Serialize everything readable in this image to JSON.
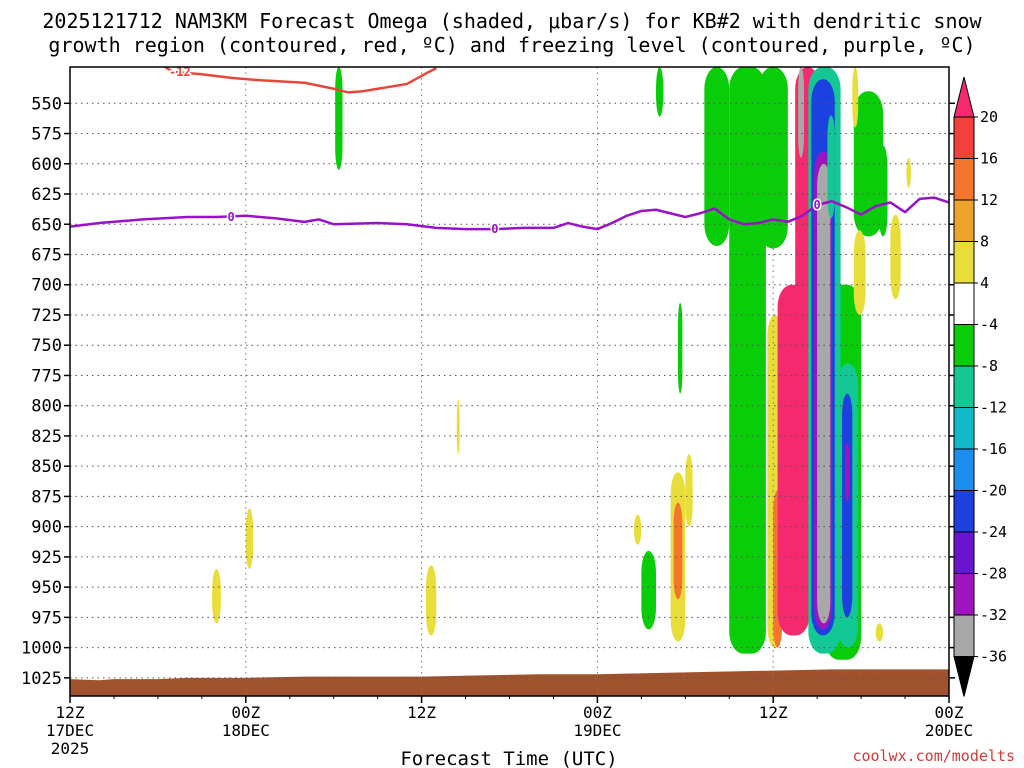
{
  "chart_data": {
    "type": "heatmap",
    "title_line1": "2025121712 NAM3KM Forecast Omega (shaded, μbar/s) for KB#2 with dendritic snow",
    "title_line2": "growth region (contoured, red, ºC) and freezing level (contoured, purple, ºC)",
    "xlabel": "Forecast Time (UTC)",
    "credit": "coolwx.com/modelts",
    "y_axis": {
      "unit": "hPa",
      "ticks": [
        550,
        575,
        600,
        625,
        650,
        675,
        700,
        725,
        750,
        775,
        800,
        825,
        850,
        875,
        900,
        925,
        950,
        975,
        1000,
        1025
      ],
      "range_top": 520,
      "range_bottom": 1040
    },
    "x_axis": {
      "range_hours": [
        0,
        60
      ],
      "ticks": [
        {
          "hour": 0,
          "lines": [
            "12Z",
            "17DEC",
            "2025"
          ]
        },
        {
          "hour": 12,
          "lines": [
            "00Z",
            "18DEC"
          ]
        },
        {
          "hour": 24,
          "lines": [
            "12Z"
          ]
        },
        {
          "hour": 36,
          "lines": [
            "00Z",
            "19DEC"
          ]
        },
        {
          "hour": 48,
          "lines": [
            "12Z"
          ]
        },
        {
          "hour": 60,
          "lines": [
            "00Z",
            "20DEC"
          ]
        }
      ]
    },
    "colorbar": {
      "levels": [
        20,
        16,
        12,
        8,
        4,
        -4,
        -8,
        -12,
        -16,
        -20,
        -24,
        -28,
        -32,
        -36
      ],
      "colors": [
        "#f52a6e",
        "#f2413a",
        "#f3762c",
        "#f0a32c",
        "#e9dd3a",
        "#ffffff",
        "#0acd0a",
        "#14c896",
        "#10b9c8",
        "#1c8ef0",
        "#1d40e0",
        "#6a14d0",
        "#a014c0",
        "#a8a8a8",
        "#000000"
      ],
      "legend_order": "top-to-bottom"
    },
    "freezing_level": {
      "label": "0",
      "color": "#9a12c8",
      "points": [
        [
          0,
          652
        ],
        [
          2,
          649
        ],
        [
          5,
          646
        ],
        [
          8,
          644
        ],
        [
          10,
          644
        ],
        [
          12,
          643
        ],
        [
          14,
          645
        ],
        [
          16,
          648
        ],
        [
          17,
          646
        ],
        [
          18,
          650
        ],
        [
          21,
          649
        ],
        [
          23,
          650
        ],
        [
          25,
          653
        ],
        [
          27,
          654
        ],
        [
          29,
          654
        ],
        [
          31,
          653
        ],
        [
          33,
          653
        ],
        [
          34,
          649
        ],
        [
          35,
          652
        ],
        [
          36,
          654
        ],
        [
          37,
          649
        ],
        [
          38,
          643
        ],
        [
          39,
          639
        ],
        [
          40,
          638
        ],
        [
          41,
          641
        ],
        [
          42,
          644
        ],
        [
          43,
          641
        ],
        [
          44,
          637
        ],
        [
          45,
          646
        ],
        [
          46,
          650
        ],
        [
          47,
          649
        ],
        [
          48,
          646
        ],
        [
          49,
          648
        ],
        [
          50,
          643
        ],
        [
          51,
          634
        ],
        [
          52,
          631
        ],
        [
          53,
          636
        ],
        [
          54,
          642
        ],
        [
          55,
          635
        ],
        [
          56,
          632
        ],
        [
          57,
          640
        ],
        [
          58,
          629
        ],
        [
          59,
          628
        ],
        [
          60,
          632
        ]
      ]
    },
    "dgz_contour": {
      "label": "-12",
      "color": "#e8463a",
      "points": [
        [
          6.5,
          520
        ],
        [
          7,
          524
        ],
        [
          9,
          526
        ],
        [
          11,
          529
        ],
        [
          13,
          531
        ],
        [
          16,
          533
        ],
        [
          18,
          538
        ],
        [
          19,
          541
        ],
        [
          20,
          540
        ],
        [
          21,
          538
        ],
        [
          23,
          534
        ],
        [
          24.5,
          524
        ],
        [
          25,
          521
        ]
      ]
    },
    "omega_regions": [
      {
        "level": -8,
        "hour_range": [
          18.1,
          18.6
        ],
        "p_range": [
          520,
          605
        ]
      },
      {
        "level": -8,
        "hour_range": [
          40.0,
          40.5
        ],
        "p_range": [
          520,
          561
        ]
      },
      {
        "level": -8,
        "hour_range": [
          43.3,
          45.0
        ],
        "p_range": [
          520,
          668
        ]
      },
      {
        "level": -8,
        "hour_range": [
          45.0,
          47.5
        ],
        "p_range": [
          520,
          1005
        ]
      },
      {
        "level": -8,
        "hour_range": [
          47.0,
          49.0
        ],
        "p_range": [
          520,
          670
        ]
      },
      {
        "level": -8,
        "hour_range": [
          51.5,
          54.0
        ],
        "p_range": [
          700,
          1010
        ]
      },
      {
        "level": -8,
        "hour_range": [
          53.5,
          55.5
        ],
        "p_range": [
          540,
          660
        ]
      },
      {
        "level": -8,
        "hour_range": [
          55.2,
          55.8
        ],
        "p_range": [
          585,
          660
        ]
      },
      {
        "level": -8,
        "hour_range": [
          39.0,
          40.0
        ],
        "p_range": [
          920,
          985
        ]
      },
      {
        "level": -8,
        "hour_range": [
          41.5,
          41.8
        ],
        "p_range": [
          715,
          790
        ]
      },
      {
        "level": 4,
        "hour_range": [
          38.5,
          39.0
        ],
        "p_range": [
          890,
          915
        ]
      },
      {
        "level": 4,
        "hour_range": [
          41.0,
          42.0
        ],
        "p_range": [
          855,
          995
        ]
      },
      {
        "level": 4,
        "hour_range": [
          42.0,
          42.5
        ],
        "p_range": [
          840,
          900
        ]
      },
      {
        "level": 4,
        "hour_range": [
          26.4,
          26.6
        ],
        "p_range": [
          795,
          840
        ]
      },
      {
        "level": 4,
        "hour_range": [
          24.3,
          25.0
        ],
        "p_range": [
          932,
          990
        ]
      },
      {
        "level": 4,
        "hour_range": [
          12.0,
          12.5
        ],
        "p_range": [
          885,
          935
        ]
      },
      {
        "level": 4,
        "hour_range": [
          9.7,
          10.3
        ],
        "p_range": [
          935,
          980
        ]
      },
      {
        "level": 4,
        "hour_range": [
          53.5,
          54.3
        ],
        "p_range": [
          655,
          725
        ]
      },
      {
        "level": 4,
        "hour_range": [
          56.0,
          56.7
        ],
        "p_range": [
          642,
          712
        ]
      },
      {
        "level": 4,
        "hour_range": [
          57.1,
          57.4
        ],
        "p_range": [
          595,
          620
        ]
      },
      {
        "level": 4,
        "hour_range": [
          55.0,
          55.5
        ],
        "p_range": [
          980,
          995
        ]
      },
      {
        "level": 4,
        "hour_range": [
          53.4,
          53.8
        ],
        "p_range": [
          520,
          570
        ]
      },
      {
        "level": 12,
        "hour_range": [
          41.2,
          41.8
        ],
        "p_range": [
          880,
          960
        ]
      },
      {
        "level": 4,
        "hour_range": [
          47.6,
          48.6
        ],
        "p_range": [
          725,
          1000
        ]
      },
      {
        "level": 12,
        "hour_range": [
          48.0,
          48.6
        ],
        "p_range": [
          870,
          1000
        ]
      },
      {
        "level": 20,
        "hour_range": [
          48.3,
          50.5
        ],
        "p_range": [
          700,
          990
        ]
      },
      {
        "level": 20,
        "hour_range": [
          49.5,
          51.2
        ],
        "p_range": [
          520,
          720
        ]
      },
      {
        "level": -12,
        "hour_range": [
          50.4,
          52.6
        ],
        "p_range": [
          520,
          1005
        ]
      },
      {
        "level": -24,
        "hour_range": [
          50.6,
          52.2
        ],
        "p_range": [
          530,
          990
        ]
      },
      {
        "level": -32,
        "hour_range": [
          50.8,
          52.0
        ],
        "p_range": [
          590,
          985
        ]
      },
      {
        "level": -36,
        "hour_range": [
          51.0,
          51.9
        ],
        "p_range": [
          600,
          980
        ]
      },
      {
        "level": -36,
        "hour_range": [
          49.7,
          50.1
        ],
        "p_range": [
          520,
          595
        ]
      },
      {
        "level": -12,
        "hour_range": [
          52.4,
          53.8
        ],
        "p_range": [
          765,
          1000
        ]
      },
      {
        "level": -24,
        "hour_range": [
          52.7,
          53.4
        ],
        "p_range": [
          790,
          975
        ]
      },
      {
        "level": -32,
        "hour_range": [
          52.9,
          53.2
        ],
        "p_range": [
          830,
          880
        ]
      },
      {
        "level": -12,
        "hour_range": [
          51.7,
          52.2
        ],
        "p_range": [
          560,
          645
        ]
      }
    ],
    "terrain": {
      "color": "#a0522d",
      "base_hpa": 1040,
      "points": [
        [
          0,
          1026
        ],
        [
          2,
          1027
        ],
        [
          3,
          1026
        ],
        [
          6,
          1026
        ],
        [
          8,
          1025
        ],
        [
          12,
          1025
        ],
        [
          16,
          1024
        ],
        [
          20,
          1024
        ],
        [
          24,
          1024
        ],
        [
          28,
          1023
        ],
        [
          32,
          1022
        ],
        [
          36,
          1022
        ],
        [
          40,
          1021
        ],
        [
          44,
          1020
        ],
        [
          48,
          1019
        ],
        [
          52,
          1018
        ],
        [
          56,
          1018
        ],
        [
          60,
          1018
        ]
      ]
    },
    "grid": true,
    "legend_position": "right"
  }
}
